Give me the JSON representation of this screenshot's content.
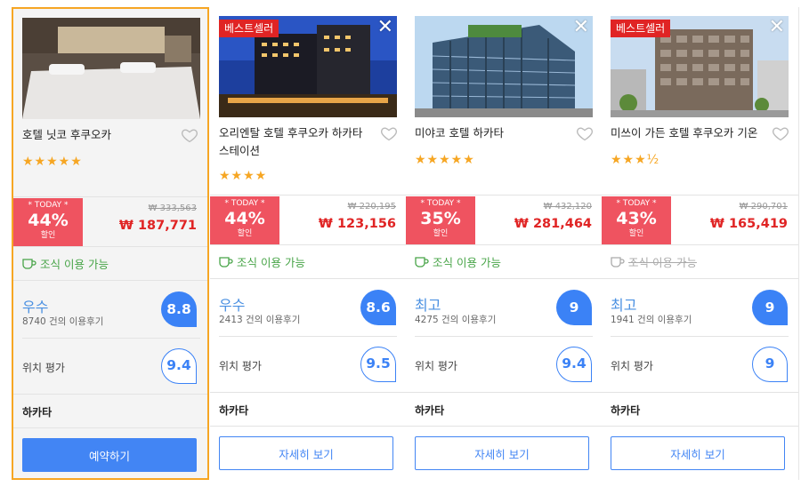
{
  "colors": {
    "accent": "#4285f4",
    "sale_red": "#e02424",
    "today_badge": "#ef5360",
    "star": "#f6a623",
    "breakfast_green": "#47a447",
    "selected_border": "#f6a623"
  },
  "labels": {
    "today": "* TODAY *",
    "discount_suffix": "할인",
    "breakfast": "조식 이용 가능",
    "location": "위치 평가",
    "bestseller": "베스트셀러"
  },
  "hotels": [
    {
      "name": "호텔 닛코 후쿠오카",
      "stars_text": "★★★★★",
      "discount": "44%",
      "old_price": "₩ 333,563",
      "new_price": "₩ 187,771",
      "breakfast_available": true,
      "grade": "우수",
      "reviews": "8740 건의 이용후기",
      "score": "8.8",
      "location_score": "9.4",
      "area": "하카타",
      "button": "예약하기",
      "bestseller": false,
      "closable": false
    },
    {
      "name": "오리엔탈 호텔 후쿠오카 하카타 스테이션",
      "stars_text": "★★★★",
      "discount": "44%",
      "old_price": "₩ 220,195",
      "new_price": "₩ 123,156",
      "breakfast_available": true,
      "grade": "우수",
      "reviews": "2413 건의 이용후기",
      "score": "8.6",
      "location_score": "9.5",
      "area": "하카타",
      "button": "자세히 보기",
      "bestseller": true,
      "closable": true
    },
    {
      "name": "미야코 호텔 하카타",
      "stars_text": "★★★★★",
      "discount": "35%",
      "old_price": "₩ 432,120",
      "new_price": "₩ 281,464",
      "breakfast_available": true,
      "grade": "최고",
      "reviews": "4275 건의 이용후기",
      "score": "9",
      "location_score": "9.4",
      "area": "하카타",
      "button": "자세히 보기",
      "bestseller": false,
      "closable": true
    },
    {
      "name": "미쓰이 가든 호텔 후쿠오카 기온",
      "stars_text": "★★★½",
      "discount": "43%",
      "old_price": "₩ 290,701",
      "new_price": "₩ 165,419",
      "breakfast_available": false,
      "grade": "최고",
      "reviews": "1941 건의 이용후기",
      "score": "9",
      "location_score": "9",
      "area": "하카타",
      "button": "자세히 보기",
      "bestseller": true,
      "closable": true
    }
  ]
}
